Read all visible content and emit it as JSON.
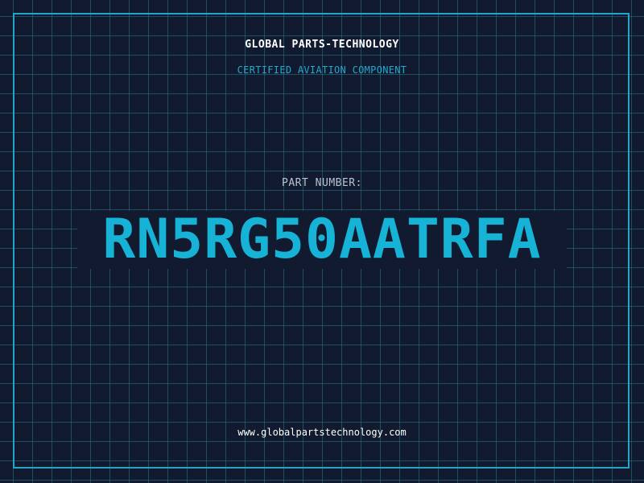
{
  "header": {
    "company": "GLOBAL PARTS-TECHNOLOGY",
    "tagline": "CERTIFIED AVIATION COMPONENT"
  },
  "part": {
    "label": "PART NUMBER:",
    "number": "RN5RG50AATRFA"
  },
  "footer": {
    "website": "www.globalpartstechnology.com"
  },
  "colors": {
    "background": "#111a2e",
    "grid": "#28788c",
    "accent": "#17b3d6",
    "frame": "#1fa6c9"
  }
}
